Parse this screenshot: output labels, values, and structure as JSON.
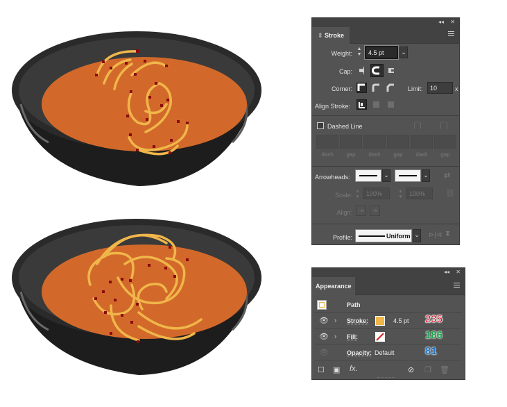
{
  "stroke_panel": {
    "collapse_glyph": "◂◂",
    "close_glyph": "✕",
    "tab_label": "Stroke",
    "weight_label": "Weight:",
    "weight_value": "4.5 pt",
    "cap_label": "Cap:",
    "corner_label": "Corner:",
    "limit_label": "Limit:",
    "limit_value": "10",
    "limit_suffix": "x",
    "align_label": "Align Stroke:",
    "dashed_label": "Dashed Line",
    "dash_labels": [
      "dash",
      "gap",
      "dash",
      "gap",
      "dash",
      "gap"
    ],
    "arrowheads_label": "Arrowheads:",
    "scale_label": "Scale:",
    "scale_start": "100%",
    "scale_end": "100%",
    "align_arrow_label": "Align:",
    "profile_label": "Profile:",
    "profile_value": "Uniform"
  },
  "appearance_panel": {
    "collapse_glyph": "◂◂",
    "close_glyph": "✕",
    "tab_label": "Appearance",
    "path_label": "Path",
    "stroke_label": "Stroke:",
    "stroke_weight": "4.5 pt",
    "stroke_color": "#f0b64a",
    "fill_label": "Fill:",
    "opacity_label": "Opacity:",
    "opacity_value": "Default"
  },
  "annotations": {
    "stroke_value": "235",
    "fill_value": "186",
    "opacity_value": "81"
  },
  "colors": {
    "soup": "#d2692a",
    "bowl": "#2a2a2a",
    "noodle": "#f0b64a",
    "anchor": "#8b0a0a",
    "panel_bg": "#535353"
  }
}
